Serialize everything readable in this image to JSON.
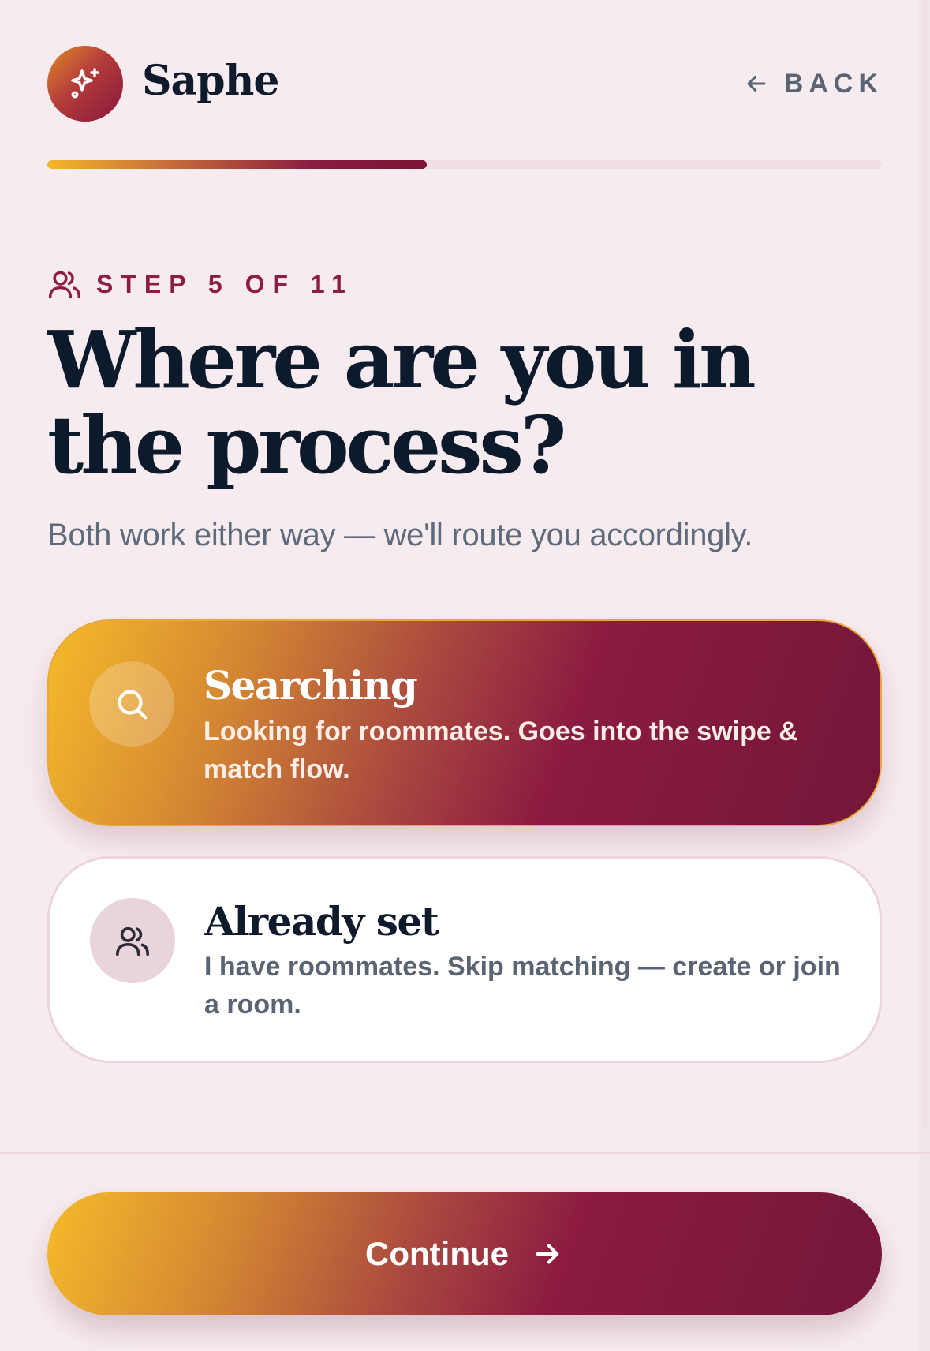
{
  "app": {
    "name": "Saphe",
    "logo_icon": "sparkles-icon"
  },
  "header": {
    "back_label": "BACK",
    "back_icon": "arrow-left-icon"
  },
  "progress": {
    "current_step": 5,
    "total_steps": 11,
    "fraction": 0.4545
  },
  "step": {
    "label": "STEP 5 OF 11",
    "icon": "users-icon"
  },
  "question": {
    "title": "Where are you in the process?",
    "subtitle": "Both work either way — we'll route you accordingly."
  },
  "options": [
    {
      "id": "searching",
      "title": "Searching",
      "description": "Looking for roommates. Goes into the swipe & match flow.",
      "icon": "search-icon",
      "selected": true
    },
    {
      "id": "already-set",
      "title": "Already set",
      "description": "I have roommates. Skip matching — create or join a room.",
      "icon": "users-icon",
      "selected": false
    }
  ],
  "footer": {
    "continue_label": "Continue",
    "continue_icon": "arrow-right-icon"
  },
  "colors": {
    "background": "#f6ecef",
    "ink": "#0d1a2c",
    "muted": "#5f6b7b",
    "accent": "#8c1e41",
    "gradient_start": "#f5bb2a",
    "gradient_end": "#73163a"
  }
}
